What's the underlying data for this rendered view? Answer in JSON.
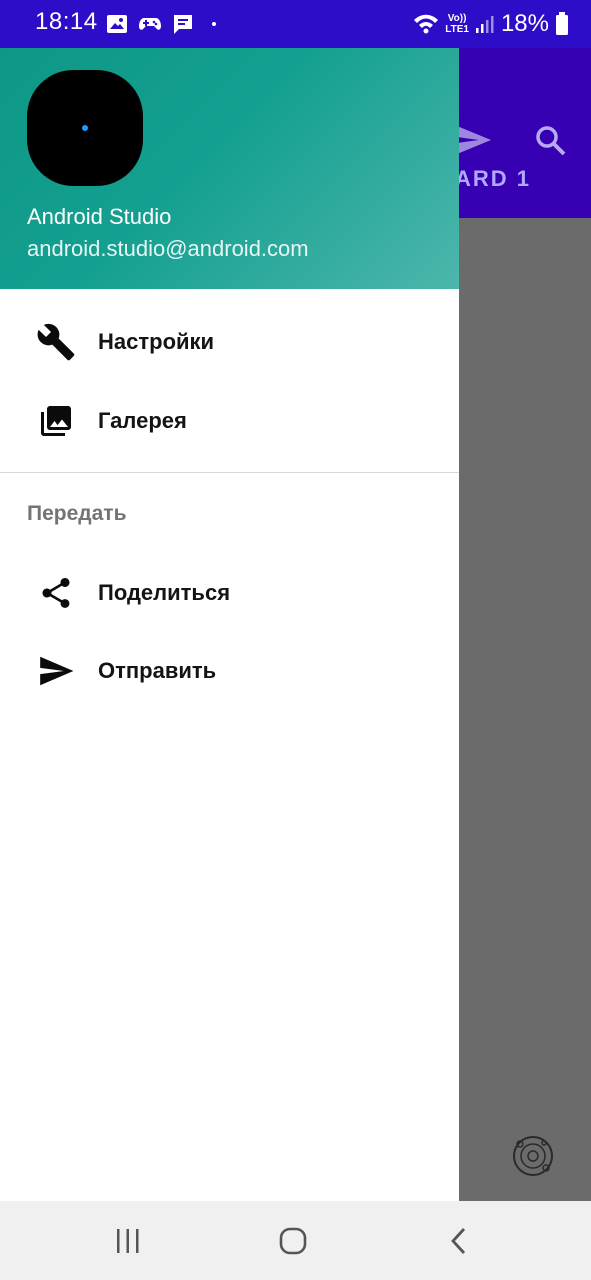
{
  "status_bar": {
    "time": "18:14",
    "battery": "18%",
    "network_top": "Vo))",
    "network_bottom": "LTE1",
    "icons": [
      "gallery-icon",
      "game-controller-icon",
      "message-icon",
      "wifi-icon",
      "signal-icon",
      "battery-icon"
    ]
  },
  "app": {
    "tab_label": "ARD 1",
    "actions": [
      "send-icon",
      "search-icon"
    ],
    "fab_icon": "plus-icon",
    "colors": {
      "toolbar": "#3700b3",
      "status_bar": "#2e0cc8",
      "fab": "#0e6e62",
      "scrim": "#6b6b6b"
    }
  },
  "drawer": {
    "header": {
      "name": "Android Studio",
      "email": "android.studio@android.com",
      "colors": {
        "start": "#0d9787",
        "end": "#4db6ac"
      }
    },
    "items": [
      {
        "label": "Настройки",
        "icon": "wrench-icon"
      },
      {
        "label": "Галерея",
        "icon": "photo-library-icon"
      }
    ],
    "section": {
      "title": "Передать",
      "items": [
        {
          "label": "Поделиться",
          "icon": "share-icon"
        },
        {
          "label": "Отправить",
          "icon": "send-icon"
        }
      ]
    }
  },
  "nav_bar": {
    "buttons": [
      "recent-apps-icon",
      "home-icon",
      "back-icon"
    ]
  }
}
